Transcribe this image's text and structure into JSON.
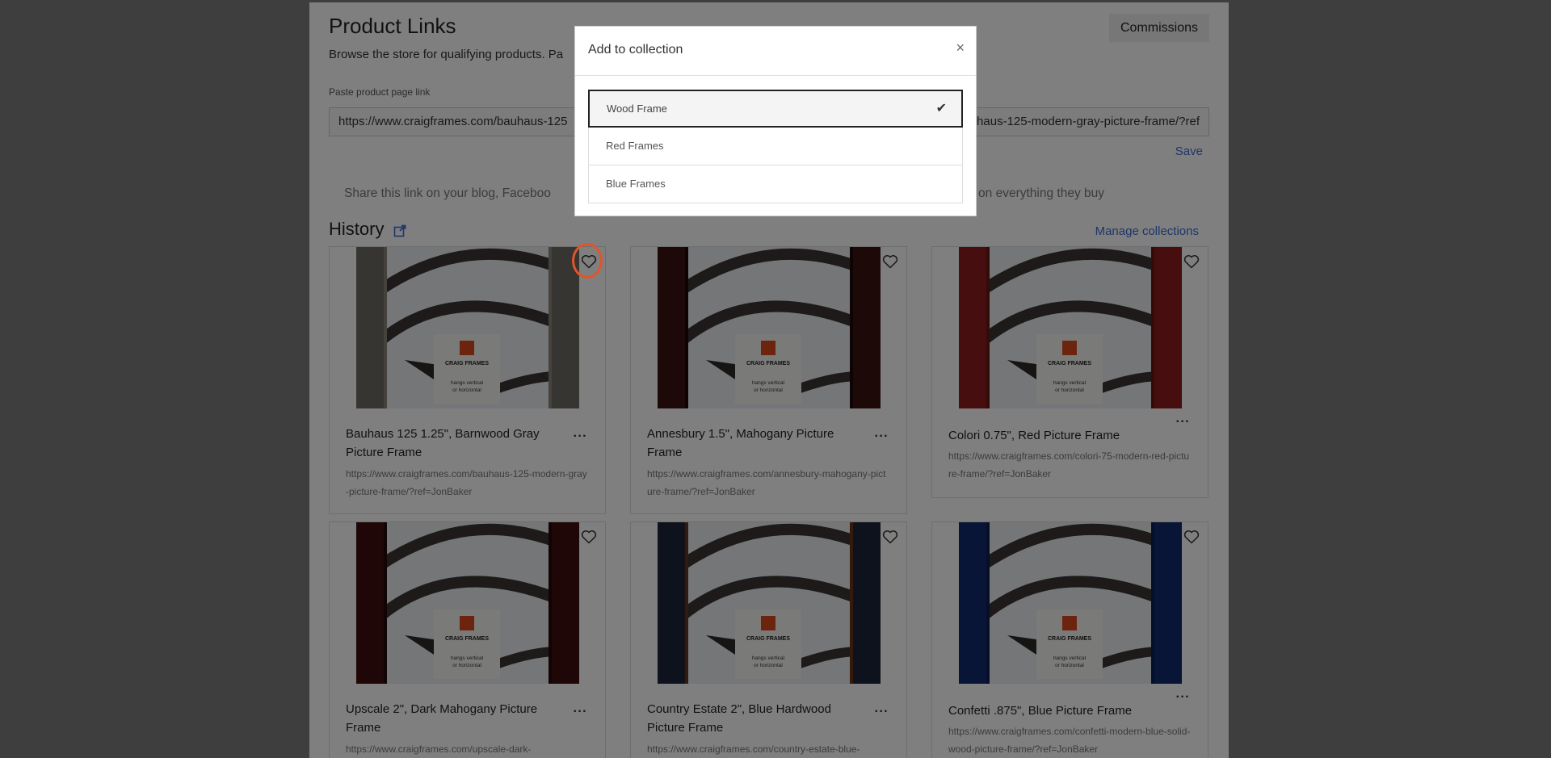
{
  "page": {
    "title": "Product Links",
    "commissions_label": "Commissions",
    "description": "Browse the store for qualifying products. Pa",
    "paste_label": "Paste product page link",
    "link_value_left": "https://www.craigframes.com/bauhaus-125",
    "link_value_right": "haus-125-modern-gray-picture-frame/?ref",
    "save_label": "Save",
    "share_text_left": "Share this link on your blog, Faceboo",
    "share_text_right": "mmissions on everything they buy",
    "history_title": "History",
    "manage_collections_label": "Manage collections"
  },
  "products": [
    {
      "title": "Bauhaus 125 1.25\", Barnwood Gray Picture Frame",
      "url": "https://www.craigframes.com/bauhaus-125-modern-gray-picture-frame/?ref=JonBaker",
      "frame_color": "#6e6a64",
      "frame_accent": "#8a857d"
    },
    {
      "title": "Annesbury 1.5\", Mahogany Picture Frame",
      "url": "https://www.craigframes.com/annesbury-mahogany-picture-frame/?ref=JonBaker",
      "frame_color": "#3a1410",
      "frame_accent": "#1a0806"
    },
    {
      "title": "Colori 0.75\", Red Picture Frame",
      "url": "https://www.craigframes.com/colori-75-modern-red-picture-frame/?ref=JonBaker",
      "frame_color": "#8c1c1c",
      "frame_accent": "#6a1414"
    },
    {
      "title": "Upscale 2\", Dark Mahogany Picture Frame",
      "url": "https://www.craigframes.com/upscale-dark-",
      "frame_color": "#3c0e0c",
      "frame_accent": "#24080a"
    },
    {
      "title": "Country Estate 2\", Blue Hardwood Picture Frame",
      "url": "https://www.craigframes.com/country-estate-blue-",
      "frame_color": "#1c2438",
      "frame_accent": "#6a3418"
    },
    {
      "title": "Confetti .875\", Blue Picture Frame",
      "url": "https://www.craigframes.com/confetti-modern-blue-solid-wood-picture-frame/?ref=JonBaker",
      "frame_color": "#102a6c",
      "frame_accent": "#0c1e52"
    }
  ],
  "image_text": {
    "brand": "CRAIG FRAMES",
    "caption_line1": "hangs vertical",
    "caption_line2": "or horizontal"
  },
  "more_glyph": "···",
  "modal": {
    "title": "Add to collection",
    "close_glyph": "×",
    "collections": [
      {
        "name": "Wood Frame",
        "selected": true
      },
      {
        "name": "Red Frames",
        "selected": false
      },
      {
        "name": "Blue Frames",
        "selected": false
      }
    ],
    "check_glyph": "✔"
  },
  "colors": {
    "accent_link": "#3d6cd2",
    "highlight": "#e0552b",
    "overlay": "rgba(0,0,0,0.5)"
  }
}
